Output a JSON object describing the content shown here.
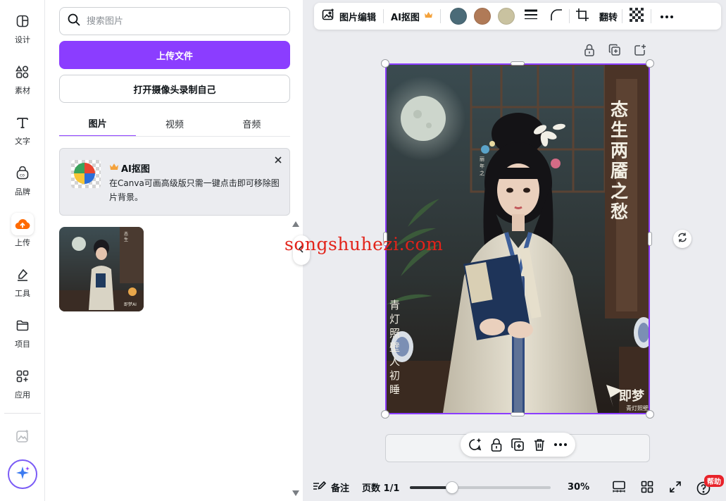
{
  "sidebar": {
    "items": [
      {
        "label": "设计",
        "icon": "layout-icon"
      },
      {
        "label": "素材",
        "icon": "shapes-icon"
      },
      {
        "label": "文字",
        "icon": "text-icon"
      },
      {
        "label": "品牌",
        "icon": "brand-icon"
      },
      {
        "label": "上传",
        "icon": "upload-cloud-icon",
        "active": true
      },
      {
        "label": "工具",
        "icon": "draw-icon"
      },
      {
        "label": "项目",
        "icon": "folder-icon"
      },
      {
        "label": "应用",
        "icon": "apps-icon"
      }
    ]
  },
  "panel": {
    "search_placeholder": "搜索图片",
    "upload_label": "上传文件",
    "camera_label": "打开摄像头录制自己",
    "tabs": [
      {
        "label": "图片",
        "active": true
      },
      {
        "label": "视频",
        "active": false
      },
      {
        "label": "音频",
        "active": false
      }
    ],
    "ai_card": {
      "title": "AI抠图",
      "description": "在Canva可画高级版只需一键点击即可移除图片背景。"
    }
  },
  "toolbar": {
    "edit_image": "图片编辑",
    "ai_cutout": "AI抠图",
    "flip": "翻转",
    "colors": [
      "#4b6b78",
      "#b07a57",
      "#c9c2a0"
    ]
  },
  "canvas": {
    "poster_title": "态生两靥之愁",
    "poster_subtitle": "青灯照壁人初睡",
    "poster_logo": "即梦",
    "poster_logo_sub": "青灯照壁"
  },
  "watermark": "songshuhezi.com",
  "bottombar": {
    "notes": "备注",
    "pages": "页数 1/1",
    "zoom": "30%",
    "zoom_level": 0.3,
    "help": "帮助"
  },
  "colors": {
    "accent": "#8b3dff",
    "upload_active": "#ff6a00"
  }
}
